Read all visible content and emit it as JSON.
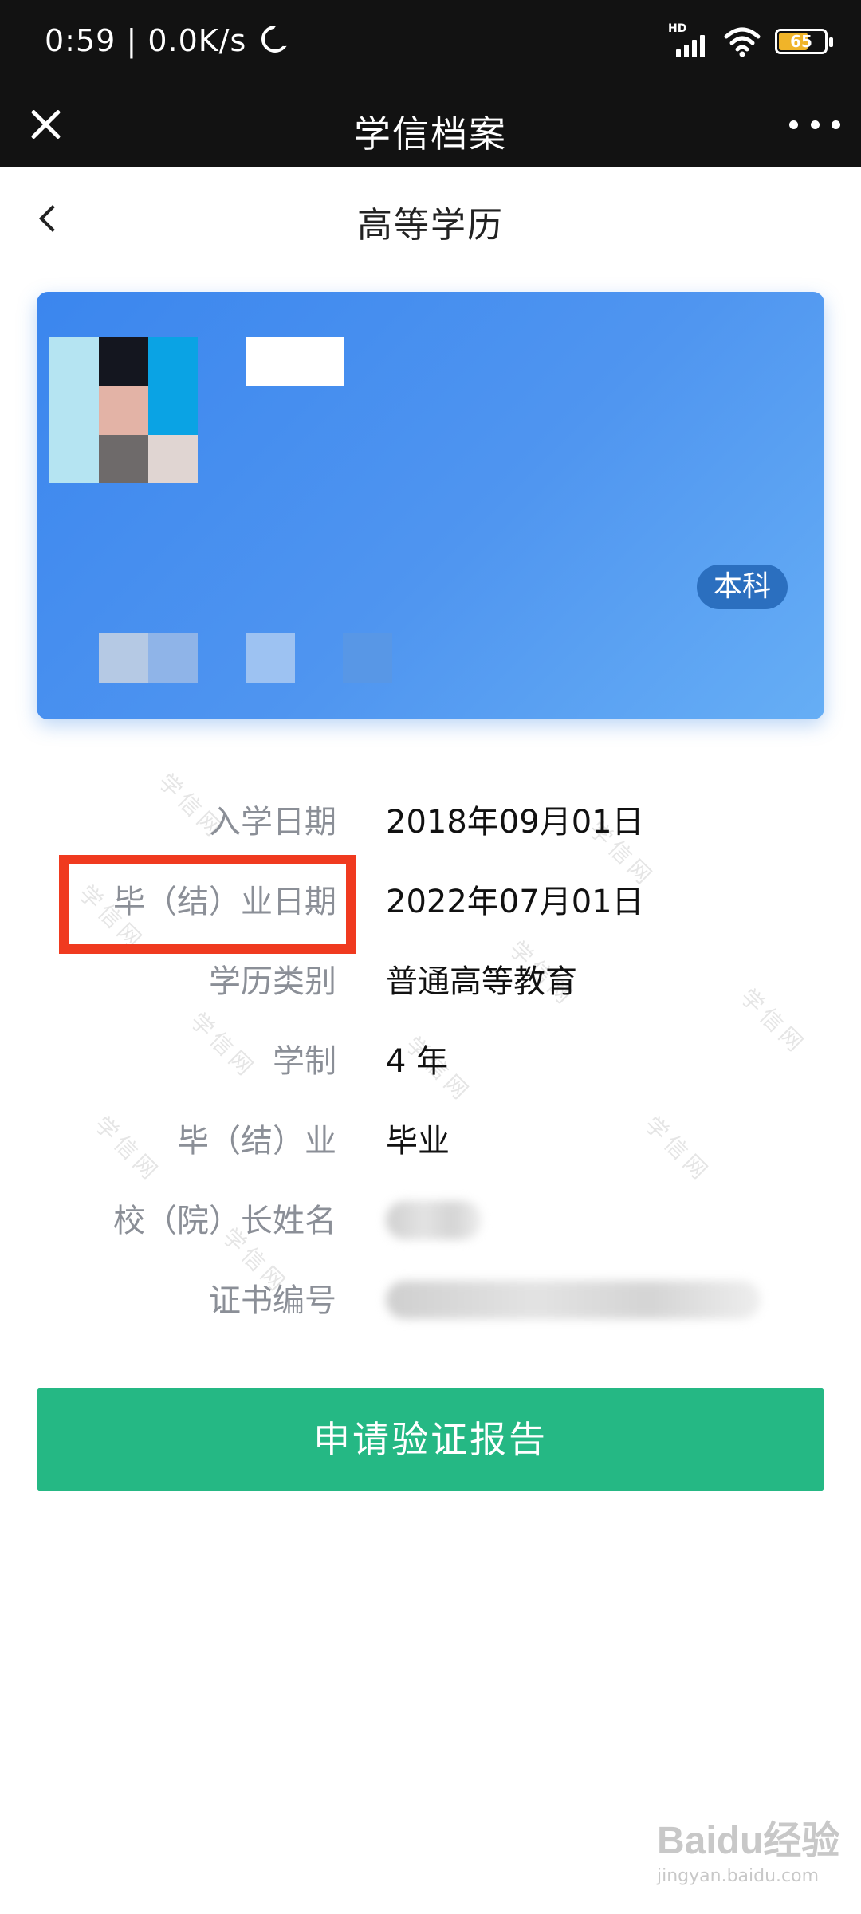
{
  "status_bar": {
    "time": "0:59",
    "net_speed": "0.0K/s",
    "network_label": "HD",
    "battery": "65"
  },
  "app_bar": {
    "title": "学信档案"
  },
  "page": {
    "title": "高等学历"
  },
  "card": {
    "degree_badge": "本科"
  },
  "details": [
    {
      "label": "入学日期",
      "value": "2018年09月01日"
    },
    {
      "label": "毕（结）业日期",
      "value": "2022年07月01日"
    },
    {
      "label": "学历类别",
      "value": "普通高等教育"
    },
    {
      "label": "学制",
      "value": "4 年"
    },
    {
      "label": "毕（结）业",
      "value": "毕业"
    },
    {
      "label": "校（院）长姓名",
      "value": ""
    },
    {
      "label": "证书编号",
      "value": ""
    }
  ],
  "watermark_text": "学信网",
  "actions": {
    "apply_report": "申请验证报告"
  },
  "footer_watermark": {
    "brand": "Baidu经验",
    "url": "jingyan.baidu.com"
  },
  "colors": {
    "card_blue": "#4a91ef",
    "badge_blue": "#2b6fbf",
    "button_green": "#25b884",
    "highlight_red": "#f03a1f"
  }
}
